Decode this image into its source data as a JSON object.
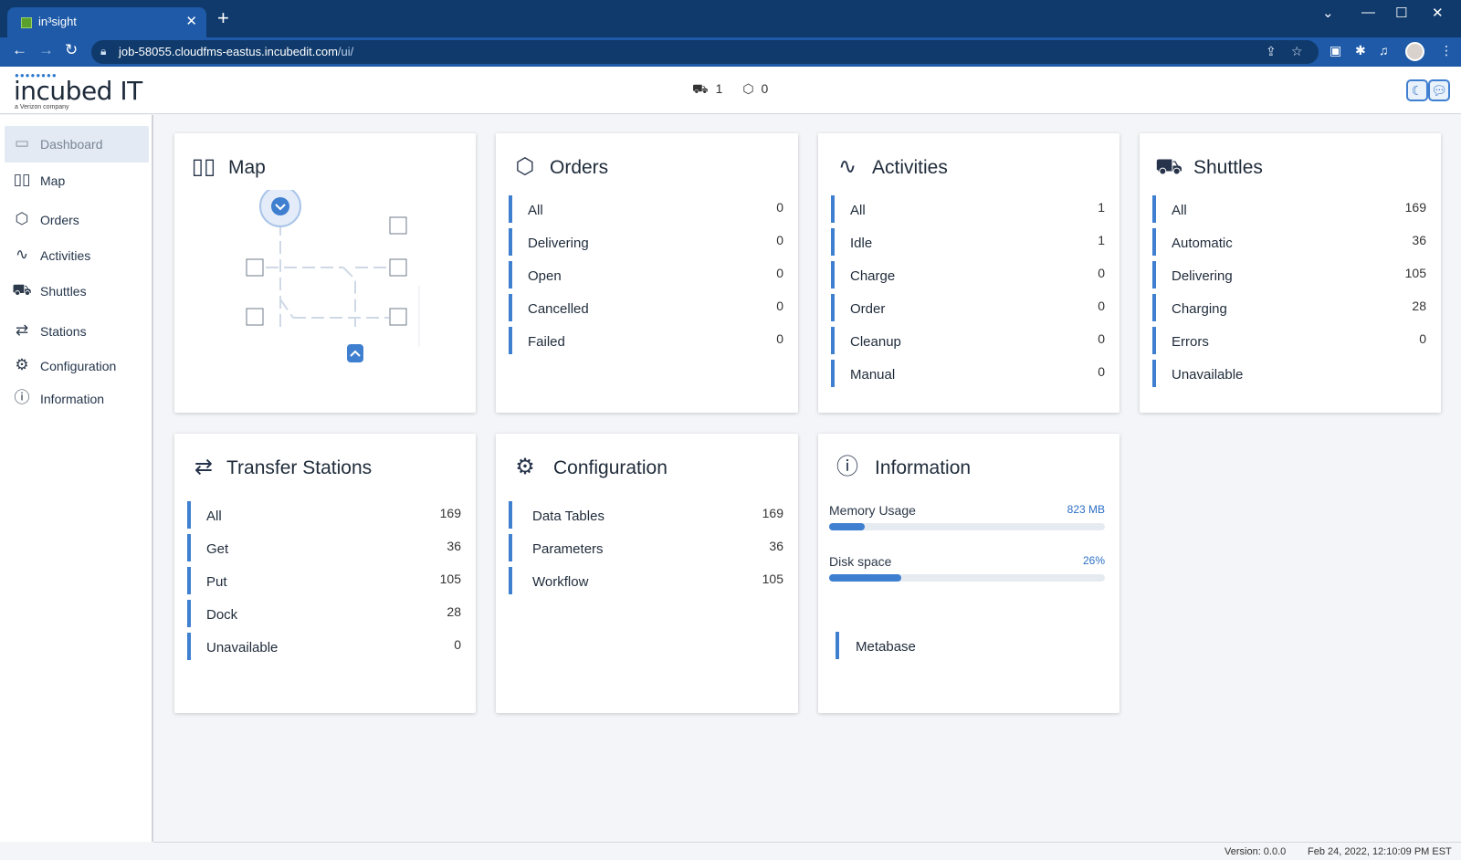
{
  "browser": {
    "tab_title": "in³sight",
    "tab_close": "✕",
    "new_tab": "+",
    "url_host": "job-58055.cloudfms-eastus.incubedit.com",
    "url_path": "/ui/"
  },
  "header": {
    "logo_text": "incubed IT",
    "logo_sub": "a Verizon company",
    "shuttle_count": "1",
    "order_count": "0"
  },
  "sidebar": {
    "items": [
      {
        "label": "Dashboard",
        "icon": "laptop-icon"
      },
      {
        "label": "Map",
        "icon": "map-icon"
      },
      {
        "label": "Orders",
        "icon": "box-icon"
      },
      {
        "label": "Activities",
        "icon": "pulse-icon"
      },
      {
        "label": "Shuttles",
        "icon": "shuttle-icon"
      },
      {
        "label": "Stations",
        "icon": "stations-icon"
      },
      {
        "label": "Configuration",
        "icon": "gear-icon"
      },
      {
        "label": "Information",
        "icon": "info-icon"
      }
    ]
  },
  "cards": {
    "map": {
      "title": "Map"
    },
    "orders": {
      "title": "Orders",
      "rows": [
        {
          "name": "All",
          "value": "0"
        },
        {
          "name": "Delivering",
          "value": "0"
        },
        {
          "name": "Open",
          "value": "0"
        },
        {
          "name": "Cancelled",
          "value": "0"
        },
        {
          "name": "Failed",
          "value": "0"
        }
      ]
    },
    "activities": {
      "title": "Activities",
      "rows": [
        {
          "name": "All",
          "value": "1"
        },
        {
          "name": "Idle",
          "value": "1"
        },
        {
          "name": "Charge",
          "value": "0"
        },
        {
          "name": "Order",
          "value": "0"
        },
        {
          "name": "Cleanup",
          "value": "0"
        },
        {
          "name": "Manual",
          "value": "0"
        }
      ]
    },
    "shuttles": {
      "title": "Shuttles",
      "rows": [
        {
          "name": "All",
          "value": "169"
        },
        {
          "name": "Automatic",
          "value": "36"
        },
        {
          "name": "Delivering",
          "value": "105"
        },
        {
          "name": "Charging",
          "value": "28"
        },
        {
          "name": "Errors",
          "value": "0"
        },
        {
          "name": "Unavailable",
          "value": ""
        }
      ]
    },
    "stations": {
      "title": "Transfer Stations",
      "rows": [
        {
          "name": "All",
          "value": "169"
        },
        {
          "name": "Get",
          "value": "36"
        },
        {
          "name": "Put",
          "value": "105"
        },
        {
          "name": "Dock",
          "value": "28"
        },
        {
          "name": "Unavailable",
          "value": "0"
        }
      ]
    },
    "configuration": {
      "title": "Configuration",
      "rows": [
        {
          "name": "Data Tables",
          "value": "169"
        },
        {
          "name": "Parameters",
          "value": "36"
        },
        {
          "name": "Workflow",
          "value": "105"
        }
      ]
    },
    "information": {
      "title": "Information",
      "memory": {
        "label": "Memory Usage",
        "value": "823 MB",
        "fraction": 0.13
      },
      "disk": {
        "label": "Disk space",
        "value": "26%",
        "fraction": 0.26
      },
      "link": "Metabase"
    }
  },
  "footer": {
    "version": "Version: 0.0.0",
    "timestamp": "Feb 24, 2022, 12:10:09 PM EST"
  },
  "colors": {
    "accent": "#3f7fd0",
    "chrome_dark": "#0f3a6b",
    "chrome_bar": "#1e5aa8"
  }
}
